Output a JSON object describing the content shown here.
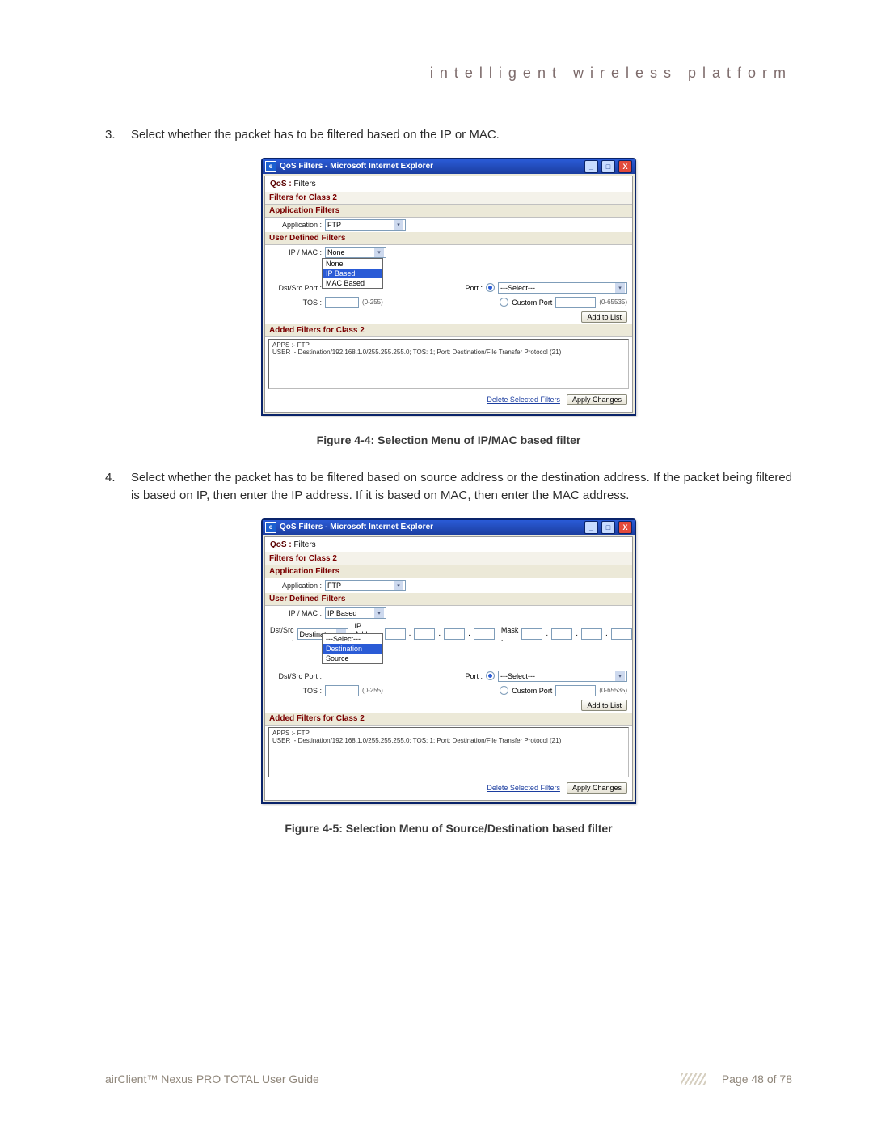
{
  "header": "intelligent   wireless   platform",
  "step3": {
    "num": "3.",
    "text": "Select whether the packet has to be filtered based on the IP or MAC."
  },
  "step4": {
    "num": "4.",
    "text": "Select whether the packet has to be filtered based on source address or the destination address. If the packet being filtered is based on IP, then enter the IP address. If it is based on MAC, then enter the MAC address."
  },
  "fig4_caption": "Figure 4-4: Selection Menu of IP/MAC based filter",
  "fig5_caption": "Figure 4-5: Selection Menu of Source/Destination based filter",
  "dialog": {
    "title": "QoS Filters - Microsoft Internet Explorer",
    "qos_label": "QoS :",
    "qos_value": "Filters",
    "filters_for": "Filters for Class 2",
    "app_filters": "Application Filters",
    "application_label": "Application :",
    "application_value": "FTP",
    "udf": "User Defined Filters",
    "ipmac_label": "IP / MAC :",
    "dstsrc_label": "Dst/Src :",
    "dstsrcport_label": "Dst/Src Port :",
    "tos_label": "TOS :",
    "ip_address_label": "IP Address :",
    "mask_label": "Mask :",
    "port_label": "Port :",
    "port_value": "---Select---",
    "custom_port_label": "Custom Port",
    "port_hint": "(0-65535)",
    "tos_hint": "(0-255)",
    "add_btn": "Add to List",
    "added_head": "Added Filters for Class 2",
    "added_line1": "APPS :- FTP",
    "added_line2": "USER :- Destination/192.168.1.0/255.255.255.0; TOS: 1; Port: Destination/File Transfer Protocol (21)",
    "delete_link": "Delete Selected Filters",
    "apply_btn": "Apply Changes"
  },
  "fig4": {
    "ipmac_value": "None",
    "dd_options": [
      "None",
      "IP Based",
      "MAC Based"
    ],
    "dd_selected_index": 1,
    "tos_value": ""
  },
  "fig5": {
    "ipmac_value": "IP Based",
    "dstsrc_value": "Destination",
    "dd_options": [
      "---Select---",
      "Destination",
      "Source"
    ],
    "dd_selected_index": 1,
    "tos_value": ""
  },
  "footer": {
    "product": "airClient™ Nexus PRO TOTAL User Guide",
    "page": "Page 48 of 78"
  }
}
